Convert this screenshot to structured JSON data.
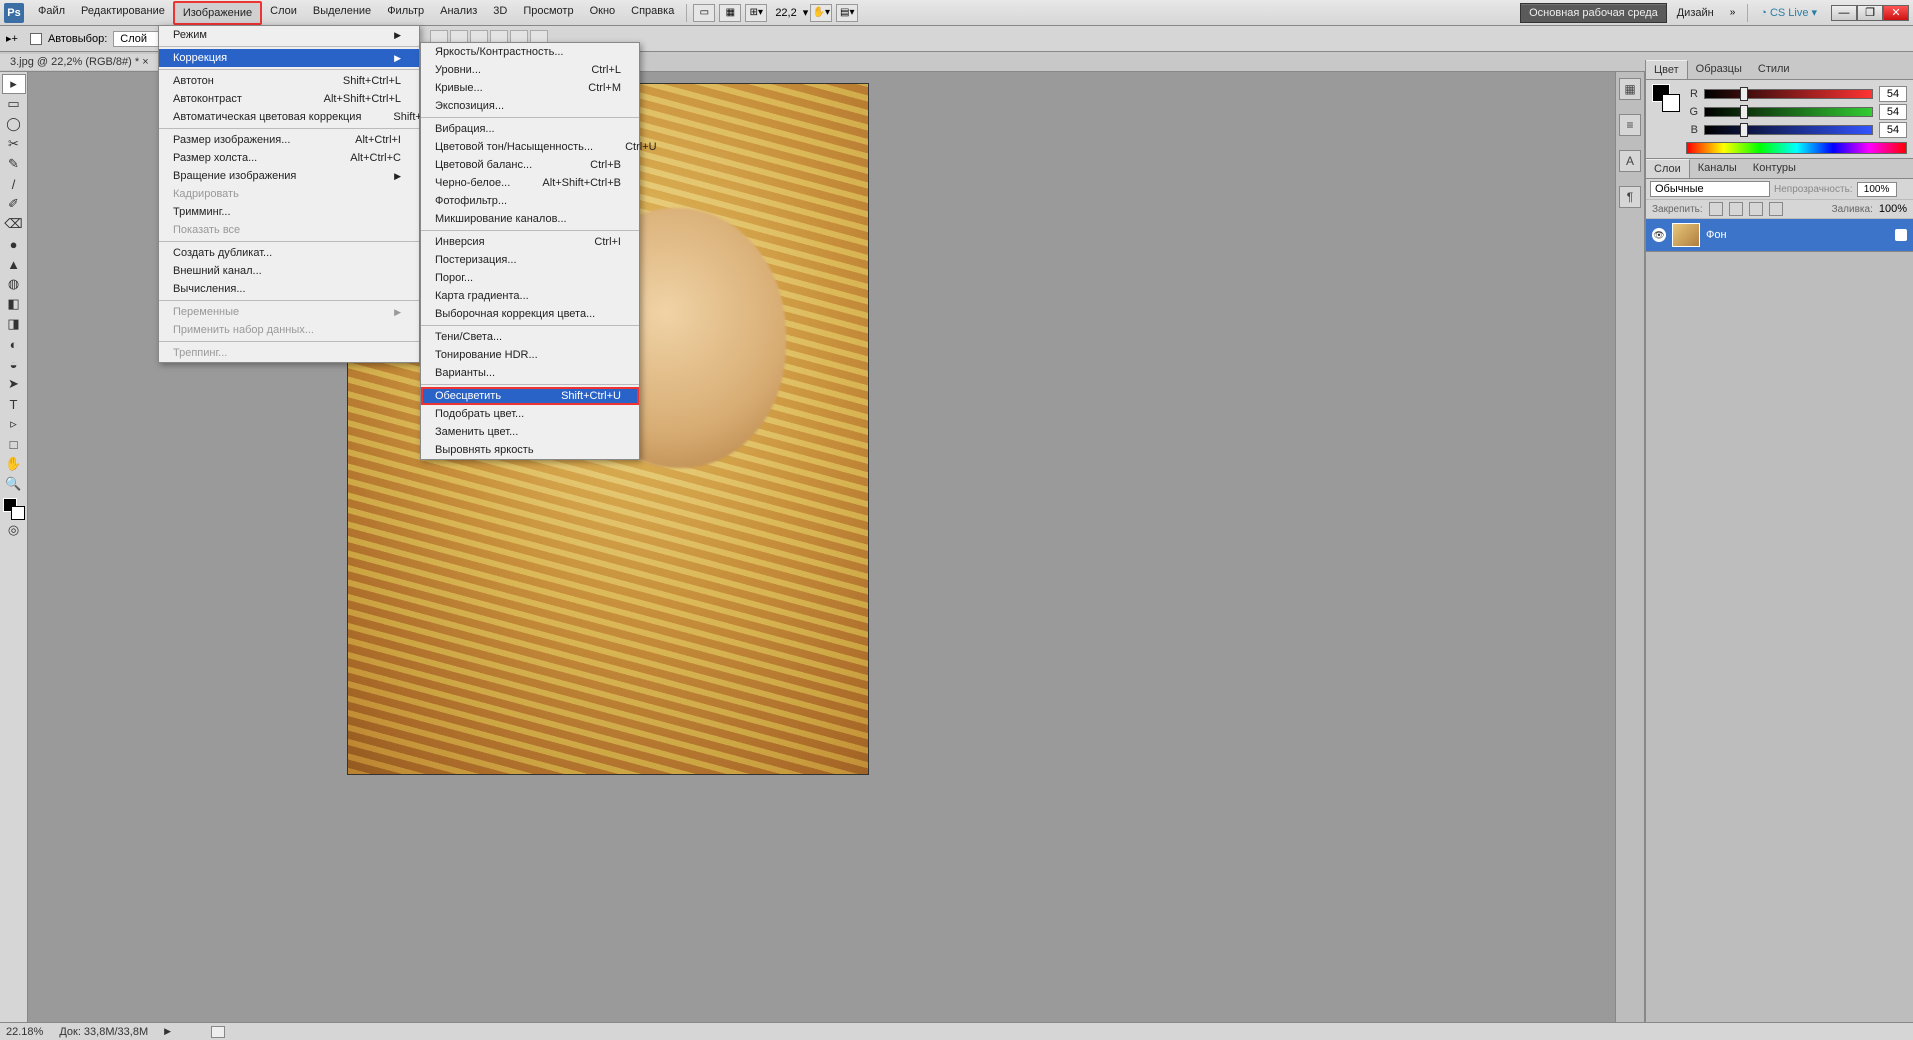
{
  "menubar": {
    "items": [
      "Файл",
      "Редактирование",
      "Изображение",
      "Слои",
      "Выделение",
      "Фильтр",
      "Анализ",
      "3D",
      "Просмотр",
      "Окно",
      "Справка"
    ],
    "highlight_index": 2,
    "zoom": "22,2",
    "workspace_main": "Основная рабочая среда",
    "workspace_design": "Дизайн",
    "cslive": "CS Live"
  },
  "optbar": {
    "auto_select": "Автовыбор:",
    "layer_sel": "Слой"
  },
  "doctab": "3.jpg @ 22,2% (RGB/8#) *",
  "tools": [
    "▸",
    "▭",
    "◯",
    "✂",
    "✎",
    "/",
    "✐",
    "⌫",
    "●",
    "▲",
    "◍",
    "◧",
    "◨",
    "◐",
    "◒",
    "➤",
    "T",
    "▹",
    "□",
    "✋",
    "🔍"
  ],
  "right_strip_icons": [
    "▦",
    "≡",
    "A",
    "¶"
  ],
  "color_panel": {
    "tabs": [
      "Цвет",
      "Образцы",
      "Стили"
    ],
    "r_label": "R",
    "g_label": "G",
    "b_label": "B",
    "r": "54",
    "g": "54",
    "b": "54"
  },
  "layers_panel": {
    "tabs": [
      "Слои",
      "Каналы",
      "Контуры"
    ],
    "mode": "Обычные",
    "opacity_label": "Непрозрачность:",
    "opacity": "100%",
    "lock_label": "Закрепить:",
    "fill_label": "Заливка:",
    "fill": "100%",
    "layer_name": "Фон"
  },
  "menu1": {
    "groups": [
      [
        {
          "label": "Режим",
          "arrow": true
        }
      ],
      [
        {
          "label": "Коррекция",
          "arrow": true,
          "hover": true
        }
      ],
      [
        {
          "label": "Автотон",
          "short": "Shift+Ctrl+L"
        },
        {
          "label": "Автоконтраст",
          "short": "Alt+Shift+Ctrl+L"
        },
        {
          "label": "Автоматическая цветовая коррекция",
          "short": "Shift+Ctrl+B"
        }
      ],
      [
        {
          "label": "Размер изображения...",
          "short": "Alt+Ctrl+I"
        },
        {
          "label": "Размер холста...",
          "short": "Alt+Ctrl+C"
        },
        {
          "label": "Вращение изображения",
          "arrow": true
        },
        {
          "label": "Кадрировать",
          "disabled": true
        },
        {
          "label": "Тримминг..."
        },
        {
          "label": "Показать все",
          "disabled": true
        }
      ],
      [
        {
          "label": "Создать дубликат..."
        },
        {
          "label": "Внешний канал..."
        },
        {
          "label": "Вычисления..."
        }
      ],
      [
        {
          "label": "Переменные",
          "arrow": true,
          "disabled": true
        },
        {
          "label": "Применить набор данных...",
          "disabled": true
        }
      ],
      [
        {
          "label": "Треппинг...",
          "disabled": true
        }
      ]
    ]
  },
  "menu2": {
    "groups": [
      [
        {
          "label": "Яркость/Контрастность..."
        },
        {
          "label": "Уровни...",
          "short": "Ctrl+L"
        },
        {
          "label": "Кривые...",
          "short": "Ctrl+M"
        },
        {
          "label": "Экспозиция..."
        }
      ],
      [
        {
          "label": "Вибрация..."
        },
        {
          "label": "Цветовой тон/Насыщенность...",
          "short": "Ctrl+U"
        },
        {
          "label": "Цветовой баланс...",
          "short": "Ctrl+B"
        },
        {
          "label": "Черно-белое...",
          "short": "Alt+Shift+Ctrl+B"
        },
        {
          "label": "Фотофильтр..."
        },
        {
          "label": "Микширование каналов..."
        }
      ],
      [
        {
          "label": "Инверсия",
          "short": "Ctrl+I"
        },
        {
          "label": "Постеризация..."
        },
        {
          "label": "Порог..."
        },
        {
          "label": "Карта градиента..."
        },
        {
          "label": "Выборочная коррекция цвета..."
        }
      ],
      [
        {
          "label": "Тени/Света..."
        },
        {
          "label": "Тонирование HDR..."
        },
        {
          "label": "Варианты..."
        }
      ],
      [
        {
          "label": "Обесцветить",
          "short": "Shift+Ctrl+U",
          "hover_red": true
        },
        {
          "label": "Подобрать цвет..."
        },
        {
          "label": "Заменить цвет..."
        },
        {
          "label": "Выровнять яркость"
        }
      ]
    ]
  },
  "statusbar": {
    "zoom": "22.18%",
    "doc": "Док: 33,8М/33,8М"
  }
}
